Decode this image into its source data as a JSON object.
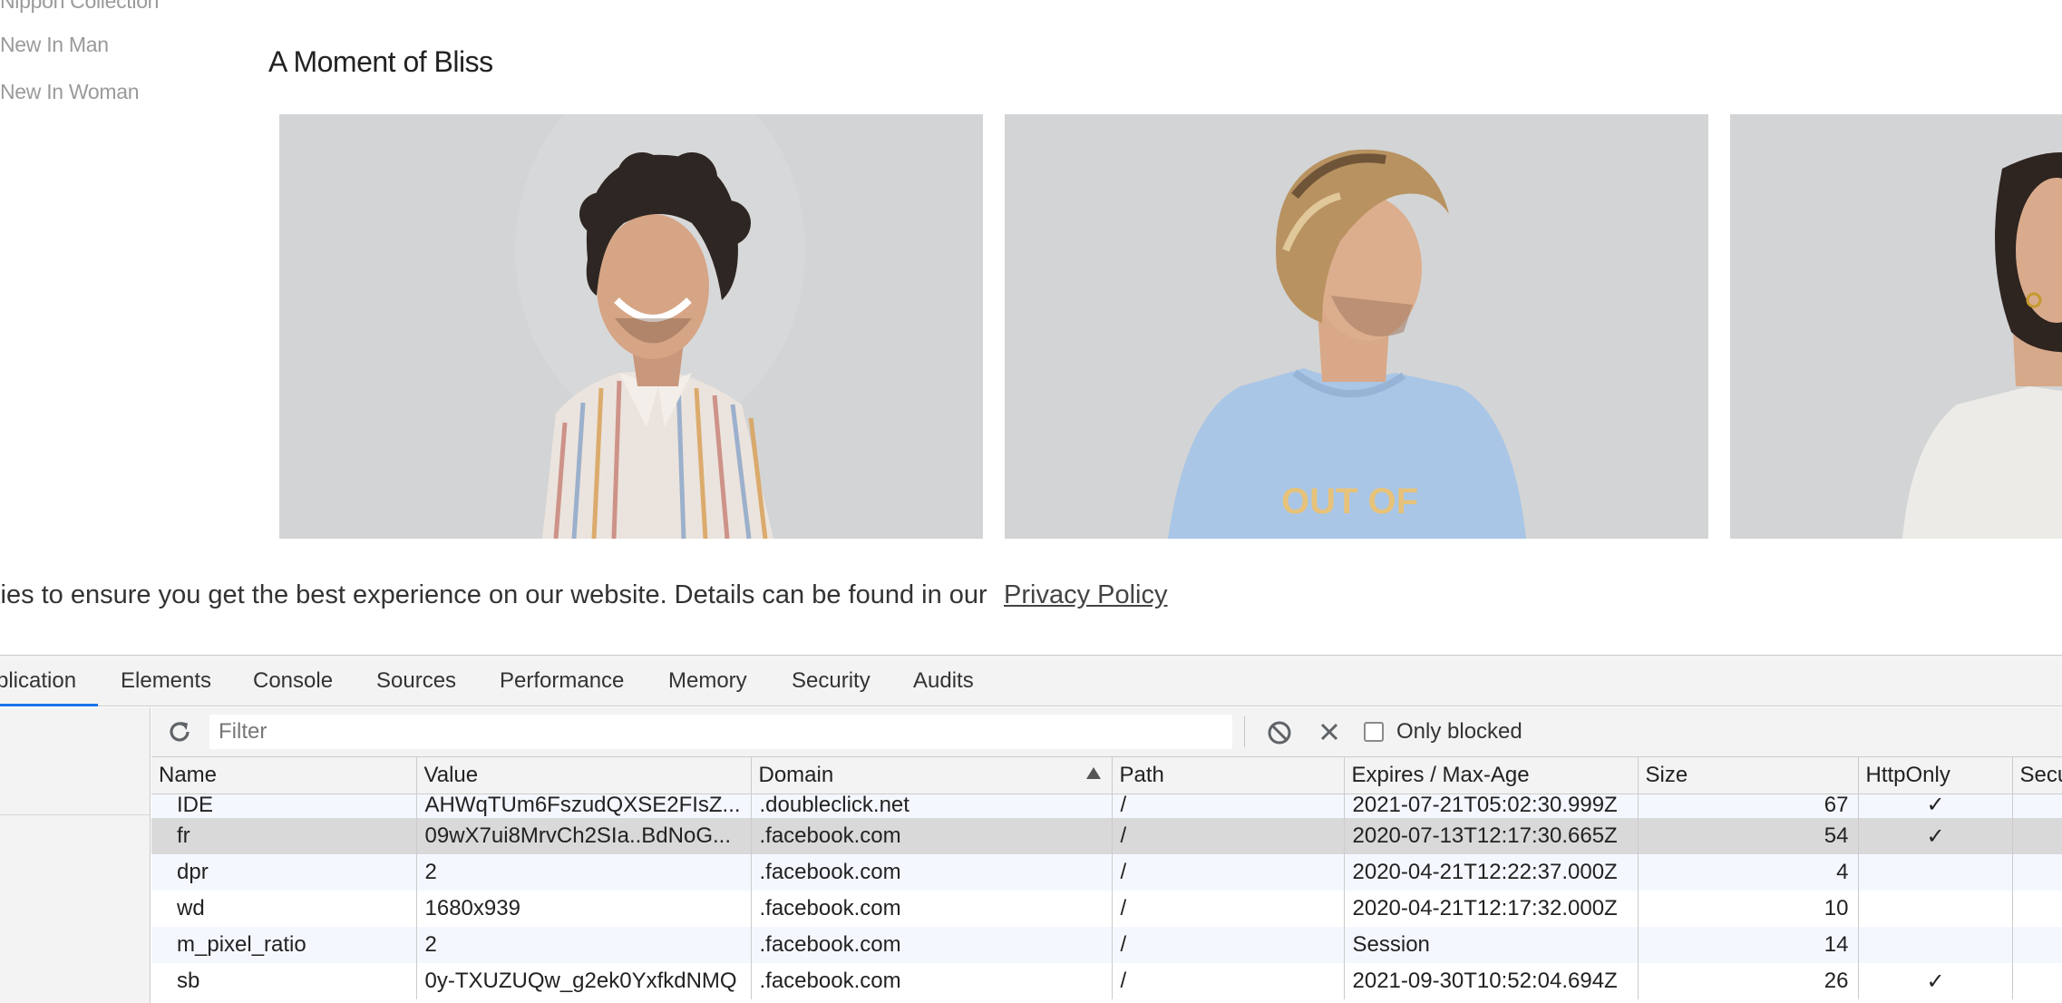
{
  "site": {
    "nav": [
      {
        "label": "Nippon Collection"
      },
      {
        "label": "New In Man"
      },
      {
        "label": "New In Woman"
      }
    ],
    "section_title": "A Moment of Bliss",
    "photo_print": "OUT OF",
    "cookie_text": "kies to ensure you get the best experience on our website. Details can be found in our",
    "cookie_link": "Privacy Policy"
  },
  "devtools": {
    "tabs": [
      {
        "label": "plication",
        "active": true
      },
      {
        "label": "Elements"
      },
      {
        "label": "Console"
      },
      {
        "label": "Sources"
      },
      {
        "label": "Performance"
      },
      {
        "label": "Memory"
      },
      {
        "label": "Security"
      },
      {
        "label": "Audits"
      }
    ],
    "toolbar": {
      "filter_placeholder": "Filter",
      "only_blocked_label": "Only blocked",
      "refresh_icon": "refresh-icon",
      "clear_icon": "block-icon",
      "delete_icon": "close-icon"
    },
    "table": {
      "columns": [
        "Name",
        "Value",
        "Domain",
        "Path",
        "Expires / Max-Age",
        "Size",
        "HttpOnly",
        "Secu"
      ],
      "sorted_column": "Domain",
      "rows": [
        {
          "name": "IDE",
          "value": "AHWqTUm6FszudQXSE2FIsZ...",
          "domain": ".doubleclick.net",
          "path": "/",
          "expires": "2021-07-21T05:02:30.999Z",
          "size": "67",
          "httponly": "✓",
          "secure": ""
        },
        {
          "name": "fr",
          "value": "09wX7ui8MrvCh2SIa..BdNoG...",
          "domain": ".facebook.com",
          "path": "/",
          "expires": "2020-07-13T12:17:30.665Z",
          "size": "54",
          "httponly": "✓",
          "secure": ""
        },
        {
          "name": "dpr",
          "value": "2",
          "domain": ".facebook.com",
          "path": "/",
          "expires": "2020-04-21T12:22:37.000Z",
          "size": "4",
          "httponly": "",
          "secure": ""
        },
        {
          "name": "wd",
          "value": "1680x939",
          "domain": ".facebook.com",
          "path": "/",
          "expires": "2020-04-21T12:17:32.000Z",
          "size": "10",
          "httponly": "",
          "secure": ""
        },
        {
          "name": "m_pixel_ratio",
          "value": "2",
          "domain": ".facebook.com",
          "path": "/",
          "expires": "Session",
          "size": "14",
          "httponly": "",
          "secure": ""
        },
        {
          "name": "sb",
          "value": "0y-TXUZUQw_g2ek0YxfkdNMQ",
          "domain": ".facebook.com",
          "path": "/",
          "expires": "2021-09-30T10:52:04.694Z",
          "size": "26",
          "httponly": "✓",
          "secure": ""
        }
      ]
    }
  },
  "colors": {
    "active_tab_underline": "#1a73e8",
    "selected_row": "#d9d9d9",
    "alt_row": "#f4f8fe",
    "panel_bg": "#f3f3f3"
  }
}
